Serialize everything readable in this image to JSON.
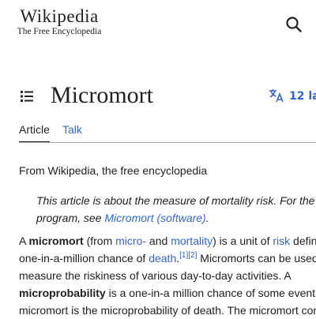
{
  "header": {
    "logo_word": "Wikipedia",
    "logo_tagline": "The Free Encyclopedia",
    "search_icon": "search-icon"
  },
  "article": {
    "toc_icon": "list-icon",
    "title": "Micromort",
    "languages_label": "12 la",
    "languages_icon": "translate-icon",
    "tabs": [
      {
        "label": "Article",
        "active": true
      },
      {
        "label": "Talk",
        "active": false
      }
    ],
    "tagline": "From Wikipedia, the free encyclopedia",
    "hatnote": {
      "text1": "This article is about the measure of mortality risk. For the",
      "text2": "program, see ",
      "link": "Micromort (software)",
      "end": "."
    },
    "paragraph": {
      "l1_a": "A ",
      "l1_b": "micromort",
      "l1_c": " (from ",
      "l1_link1": "micro-",
      "l1_d": " and ",
      "l1_link2": "mortality",
      "l1_e": ") is a unit of ",
      "l1_link3": "risk",
      "l1_f": " defin",
      "l2_a": "one-in-a-million chance of ",
      "l2_link": "death",
      "l2_b": ".",
      "l2_ref1": "[1]",
      "l2_ref2": "[2]",
      "l2_c": " Micromorts can be used",
      "l3": "measure the riskiness of various day-to-day activities. A",
      "l4_a": "microprobability",
      "l4_b": " is a one-in-a million chance of some event",
      "l5": "micromort is the microprobability of death. The micromort con"
    }
  },
  "colors": {
    "link": "#3366cc",
    "text": "#202122",
    "border": "#a2a9b1"
  }
}
